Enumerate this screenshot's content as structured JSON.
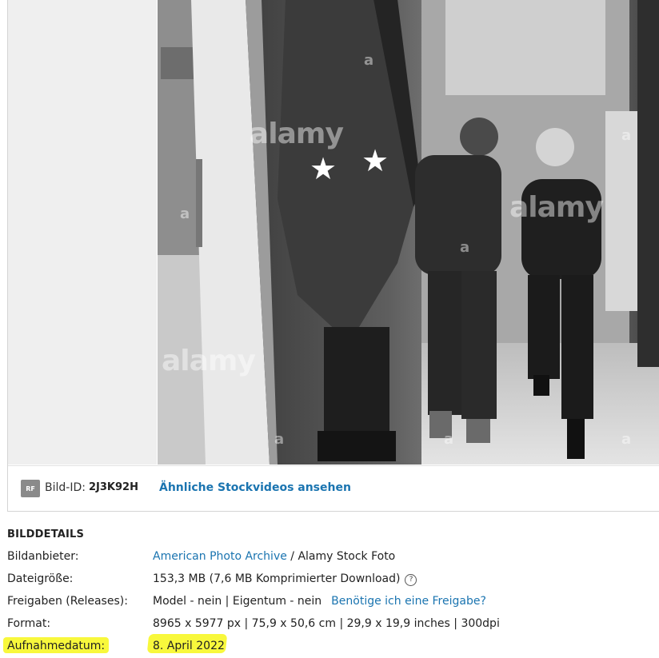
{
  "image": {
    "description_icon": "photo",
    "watermark": "alamy",
    "watermark_letter": "a"
  },
  "id_bar": {
    "badge": "RF",
    "id_label": "Bild-ID:",
    "id_value": "2J3K92H",
    "similar_link": "Ähnliche Stockvideos ansehen"
  },
  "details": {
    "title": "BILDDETAILS",
    "rows": [
      {
        "label": "Bildanbieter:",
        "link": "American Photo Archive",
        "text": " / Alamy Stock Foto"
      },
      {
        "label": "Dateigröße:",
        "text": "153,3 MB (7,6 MB Komprimierter Download)",
        "icon": "help-icon",
        "icon_glyph": "?"
      },
      {
        "label": "Freigaben (Releases):",
        "text": "Model - nein | Eigentum - nein",
        "link": "Benötige ich eine Freigabe?"
      },
      {
        "label": "Format:",
        "text": "8965 x 5977 px | 75,9 x 50,6 cm | 29,9 x 19,9 inches | 300dpi"
      },
      {
        "label": "Aufnahmedatum:",
        "text": "8. April 2022"
      }
    ]
  },
  "colors": {
    "link": "#1a74b0",
    "highlight": "#f8f83c",
    "badge": "#8a8a8a"
  }
}
